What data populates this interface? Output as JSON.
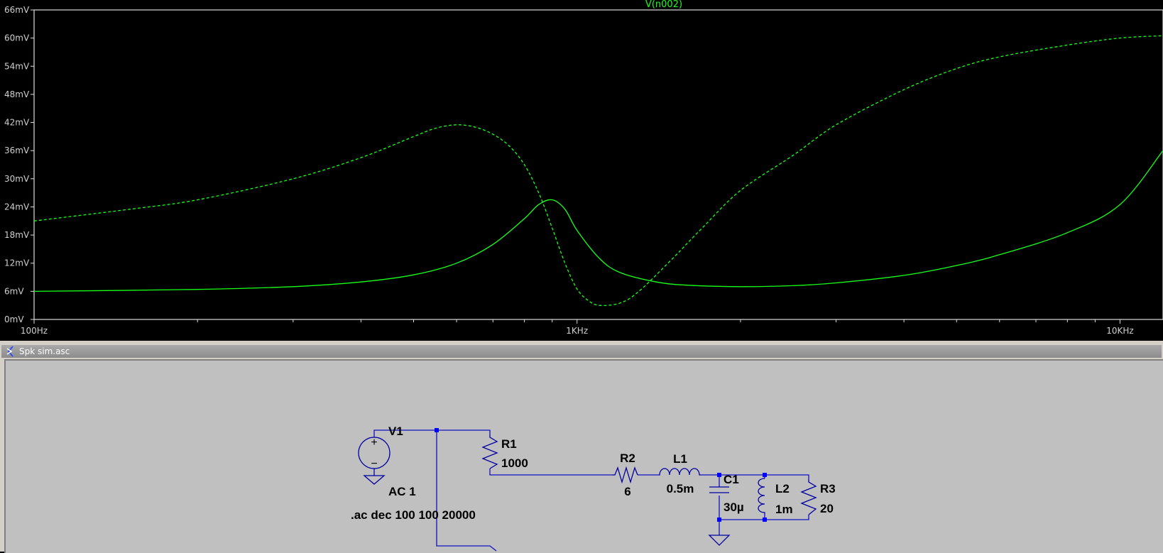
{
  "chart_data": {
    "type": "line",
    "title": "V(n002)",
    "xscale": "log",
    "xlim": [
      100,
      12000
    ],
    "ylim": [
      0,
      66
    ],
    "yunit": "mV",
    "xticks": [
      "100Hz",
      "1KHz",
      "10KHz"
    ],
    "yticks": [
      "0mV",
      "6mV",
      "12mV",
      "18mV",
      "24mV",
      "30mV",
      "36mV",
      "42mV",
      "48mV",
      "54mV",
      "60mV",
      "66mV"
    ],
    "color": "#17ff17",
    "series": [
      {
        "style": "solid",
        "x": [
          100,
          200,
          300,
          400,
          500,
          600,
          700,
          800,
          850,
          900,
          950,
          1000,
          1100,
          1200,
          1400,
          1600,
          2000,
          2500,
          3000,
          4000,
          5000,
          6000,
          8000,
          10000,
          12000
        ],
        "y": [
          6.0,
          6.4,
          7.0,
          8.0,
          9.5,
          12.0,
          16.0,
          21.5,
          24.5,
          25.5,
          23.5,
          19.0,
          13.0,
          10.0,
          8.0,
          7.3,
          7.0,
          7.2,
          7.8,
          9.4,
          11.5,
          13.8,
          18.5,
          24.5,
          36.0
        ]
      },
      {
        "style": "dashed",
        "x": [
          100,
          150,
          200,
          300,
          400,
          500,
          550,
          600,
          650,
          700,
          750,
          800,
          850,
          900,
          950,
          1000,
          1050,
          1100,
          1200,
          1300,
          1500,
          1700,
          2000,
          2500,
          3000,
          4000,
          5000,
          6000,
          8000,
          10000,
          12000
        ],
        "y": [
          21.0,
          23.5,
          25.5,
          30.0,
          34.5,
          39.0,
          40.8,
          41.5,
          41.0,
          39.5,
          37.0,
          33.0,
          27.0,
          19.5,
          12.0,
          6.5,
          4.0,
          3.0,
          3.5,
          6.0,
          13.0,
          19.5,
          27.5,
          35.0,
          41.5,
          49.0,
          53.5,
          56.0,
          58.5,
          60.0,
          60.5
        ]
      }
    ]
  },
  "schematic_window": {
    "title": "Spk sim.asc",
    "source_plus": "+",
    "source_minus": "−",
    "components": {
      "v1_name": "V1",
      "v1_value": "AC 1",
      "r1_name": "R1",
      "r1_value": "1000",
      "r2_name": "R2",
      "r2_value": "6",
      "l1_name": "L1",
      "l1_value": "0.5m",
      "c1_name": "C1",
      "c1_value": "30µ",
      "l2_name": "L2",
      "l2_value": "1m",
      "r3_name": "R3",
      "r3_value": "20"
    },
    "directive": ".ac dec 100 100 20000",
    "colors": {
      "wire": "#1010c0",
      "junction": "#0000ff",
      "component": "#0000a0"
    }
  }
}
